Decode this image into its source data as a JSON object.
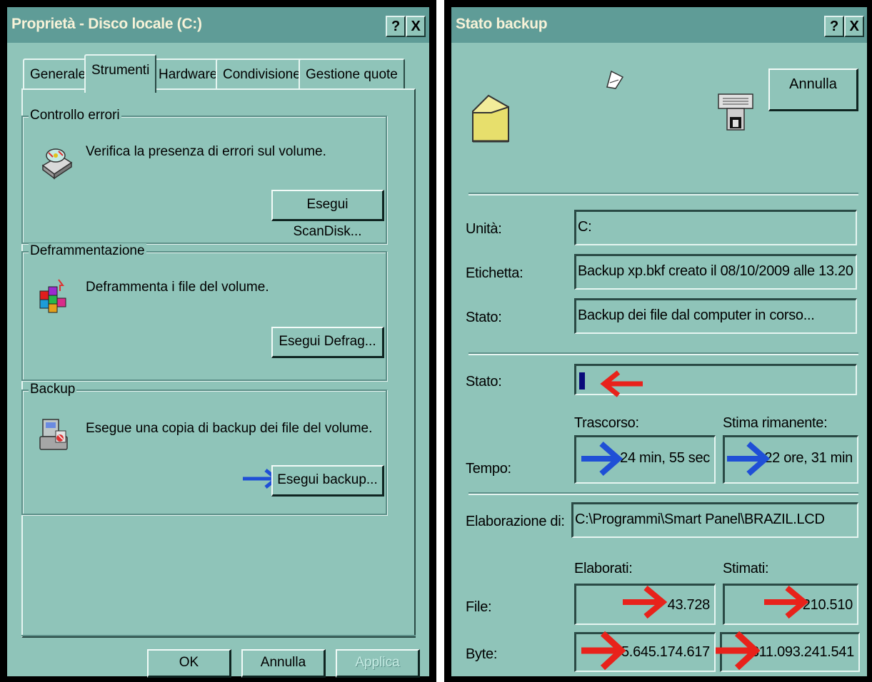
{
  "left": {
    "title": "Proprietà - Disco locale (C:)",
    "help_label": "?",
    "close_label": "X",
    "tabs": [
      "Generale",
      "Strumenti",
      "Hardware",
      "Condivisione",
      "Gestione quote"
    ],
    "groups": [
      {
        "label": "Controllo errori",
        "description": "Verifica la presenza di errori sul volume.",
        "button": "Esegui ScanDisk...",
        "icon": "scandisk-icon"
      },
      {
        "label": "Deframmentazione",
        "description": "Deframmenta i file del volume.",
        "button": "Esegui Defrag...",
        "icon": "defrag-icon"
      },
      {
        "label": "Backup",
        "description": "Esegue una copia di backup dei file del volume.",
        "button": "Esegui backup...",
        "icon": "backup-icon"
      }
    ],
    "footer": {
      "ok": "OK",
      "cancel": "Annulla",
      "apply": "Applica"
    }
  },
  "right": {
    "title": "Stato backup",
    "help_label": "?",
    "close_label": "X",
    "cancel_button": "Annulla",
    "labels": {
      "unit": "Unità:",
      "label": "Etichetta:",
      "status": "Stato:",
      "progress": "Stato:",
      "time": "Tempo:",
      "elapsed": "Trascorso:",
      "remaining": "Stima rimanente:",
      "processing": "Elaborazione di:",
      "processed": "Elaborati:",
      "estimated": "Stimati:",
      "files": "File:",
      "bytes": "Byte:"
    },
    "values": {
      "unit": "C:",
      "label": "Backup xp.bkf creato il 08/10/2009 alle 13.20",
      "status": "Backup dei file dal computer in corso...",
      "elapsed": "24 min, 55 sec",
      "remaining": "22 ore, 31 min",
      "processing": "C:\\Programmi\\Smart Panel\\BRAZIL.LCD",
      "files_processed": "43.728",
      "files_estimated": "210.510",
      "bytes_processed": "5.645.174.617",
      "bytes_estimated": "311.093.241.541"
    },
    "progress_fraction": 0.02
  },
  "colors": {
    "dialog_bg": "#8fc4b9",
    "titlebar_bg": "#5f9c97",
    "title_text": "#f7f2d8",
    "arrow_blue": "#1f4fd6",
    "arrow_red": "#e8221b",
    "progress_fill": "#0a0a7a"
  }
}
